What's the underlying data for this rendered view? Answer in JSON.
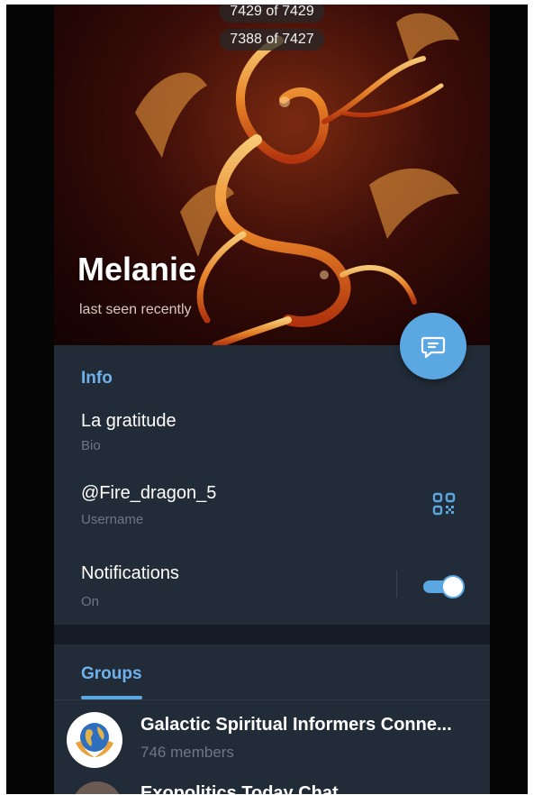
{
  "header": {
    "counter_top": "7429 of 7429",
    "counter_main": "7388 of 7427",
    "name": "Melanie",
    "status": "last seen recently"
  },
  "fab_icon": "message-icon",
  "info": {
    "section_title": "Info",
    "bio_value": "La gratitude",
    "bio_label": "Bio",
    "username_value": "@Fire_dragon_5",
    "username_label": "Username",
    "qr_icon": "qr-code-icon",
    "notifications_label": "Notifications",
    "notifications_status": "On",
    "notifications_enabled": true
  },
  "groups": {
    "tab_label": "Groups",
    "items": [
      {
        "title": "Galactic Spiritual Informers Conne...",
        "subtitle": "746 members"
      },
      {
        "title": "Exopolitics Today Chat",
        "subtitle": ""
      }
    ]
  },
  "colors": {
    "accent": "#5aa7e2",
    "panel": "#222c38",
    "muted_text": "#6c7783"
  }
}
